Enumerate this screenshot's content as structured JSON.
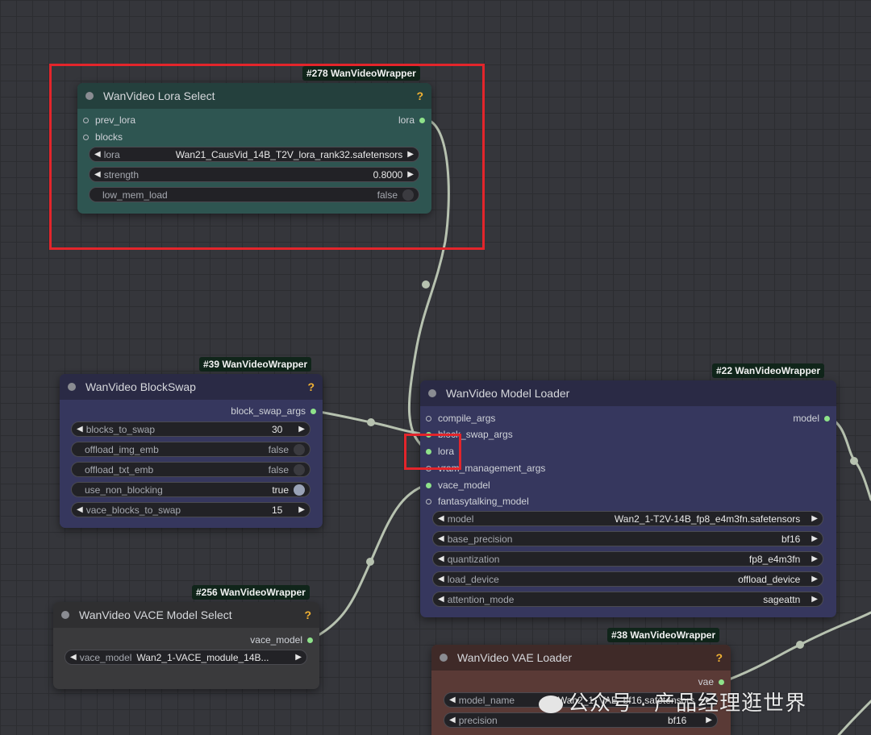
{
  "nodes": {
    "lora_select": {
      "tag": "#278 WanVideoWrapper",
      "title": "WanVideo Lora Select",
      "help": "?",
      "inputs": [
        "prev_lora",
        "blocks"
      ],
      "output": "lora",
      "widgets": {
        "lora": {
          "label": "lora",
          "value": "Wan21_CausVid_14B_T2V_lora_rank32.safetensors"
        },
        "strength": {
          "label": "strength",
          "value": "0.8000"
        },
        "low_mem_load": {
          "label": "low_mem_load",
          "value": "false"
        }
      }
    },
    "blockswap": {
      "tag": "#39 WanVideoWrapper",
      "title": "WanVideo BlockSwap",
      "help": "?",
      "output": "block_swap_args",
      "widgets": {
        "blocks_to_swap": {
          "label": "blocks_to_swap",
          "value": "30"
        },
        "offload_img_emb": {
          "label": "offload_img_emb",
          "value": "false"
        },
        "offload_txt_emb": {
          "label": "offload_txt_emb",
          "value": "false"
        },
        "use_non_blocking": {
          "label": "use_non_blocking",
          "value": "true"
        },
        "vace_blocks_to_swap": {
          "label": "vace_blocks_to_swap",
          "value": "15"
        }
      }
    },
    "vace_select": {
      "tag": "#256 WanVideoWrapper",
      "title": "WanVideo VACE Model Select",
      "help": "?",
      "output": "vace_model",
      "widgets": {
        "vace_model": {
          "label": "vace_model",
          "value": "Wan2_1-VACE_module_14B..."
        }
      }
    },
    "model_loader": {
      "tag": "#22 WanVideoWrapper",
      "title": "WanVideo Model Loader",
      "inputs": [
        "compile_args",
        "block_swap_args",
        "lora",
        "vram_management_args",
        "vace_model",
        "fantasytalking_model"
      ],
      "output": "model",
      "widgets": {
        "model": {
          "label": "model",
          "value": "Wan2_1-T2V-14B_fp8_e4m3fn.safetensors"
        },
        "base_precision": {
          "label": "base_precision",
          "value": "bf16"
        },
        "quantization": {
          "label": "quantization",
          "value": "fp8_e4m3fn"
        },
        "load_device": {
          "label": "load_device",
          "value": "offload_device"
        },
        "attention_mode": {
          "label": "attention_mode",
          "value": "sageattn"
        }
      }
    },
    "vae_loader": {
      "tag": "#38 WanVideoWrapper",
      "title": "WanVideo VAE Loader",
      "help": "?",
      "output": "vae",
      "widgets": {
        "model_name": {
          "label": "model_name",
          "value": "Wan2_1_VAE_bf16.safetensors"
        },
        "precision": {
          "label": "precision",
          "value": "bf16"
        }
      }
    }
  },
  "watermark": "公众号 · 产品经理逛世界",
  "colors": {
    "highlight": "#e3252b",
    "connected_slot": "#8ee28a",
    "wire": "#b7c2b0",
    "help": "#f2b233"
  }
}
